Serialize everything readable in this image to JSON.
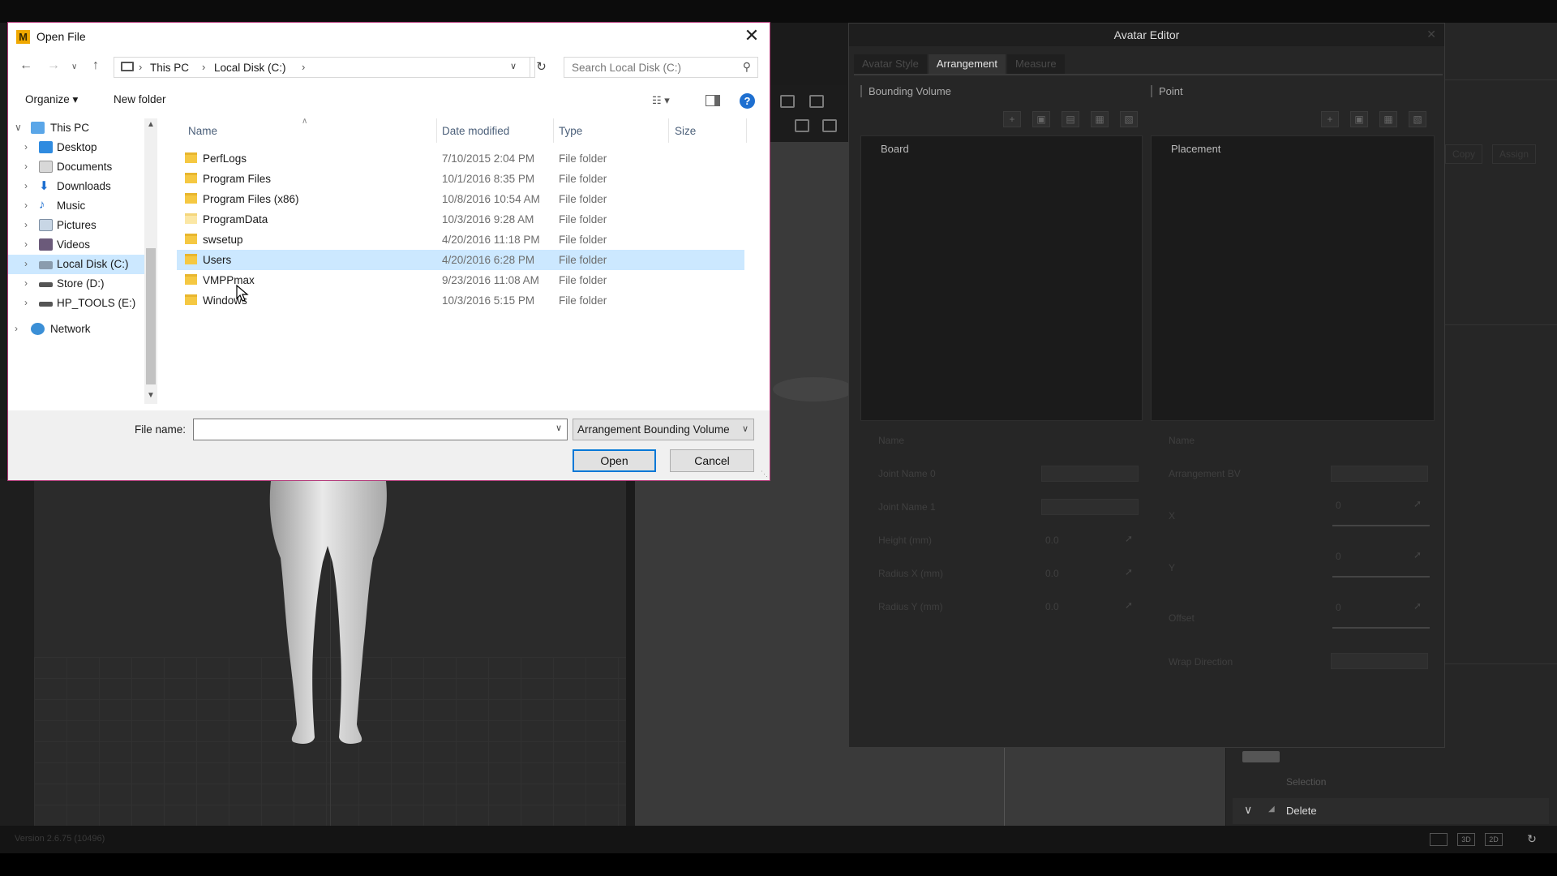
{
  "dialog": {
    "title": "Open File",
    "app_icon_letter": "M",
    "breadcrumbs": [
      "This PC",
      "Local Disk (C:)"
    ],
    "search_placeholder": "Search Local Disk (C:)",
    "organize_label": "Organize ▾",
    "new_folder_label": "New folder",
    "help_label": "?",
    "tree": [
      {
        "label": "This PC",
        "icon": "pc-icon",
        "level": 0,
        "expanded": true
      },
      {
        "label": "Desktop",
        "icon": "desktop-icon",
        "level": 1
      },
      {
        "label": "Documents",
        "icon": "documents-icon",
        "level": 1
      },
      {
        "label": "Downloads",
        "icon": "downloads-icon",
        "level": 1
      },
      {
        "label": "Music",
        "icon": "music-icon",
        "level": 1
      },
      {
        "label": "Pictures",
        "icon": "pictures-icon",
        "level": 1
      },
      {
        "label": "Videos",
        "icon": "videos-icon",
        "level": 1
      },
      {
        "label": "Local Disk (C:)",
        "icon": "drive-icon",
        "level": 1,
        "selected": true
      },
      {
        "label": "Store (D:)",
        "icon": "drive-icon",
        "level": 1
      },
      {
        "label": "HP_TOOLS (E:)",
        "icon": "drive-icon",
        "level": 1
      },
      {
        "label": "Network",
        "icon": "network-icon",
        "level": 0
      }
    ],
    "columns": [
      "Name",
      "Date modified",
      "Type",
      "Size"
    ],
    "files": [
      {
        "name": "PerfLogs",
        "date": "7/10/2015 2:04 PM",
        "type": "File folder"
      },
      {
        "name": "Program Files",
        "date": "10/1/2016 8:35 PM",
        "type": "File folder"
      },
      {
        "name": "Program Files (x86)",
        "date": "10/8/2016 10:54 AM",
        "type": "File folder"
      },
      {
        "name": "ProgramData",
        "date": "10/3/2016 9:28 AM",
        "type": "File folder",
        "hidden": true
      },
      {
        "name": "swsetup",
        "date": "4/20/2016 11:18 PM",
        "type": "File folder"
      },
      {
        "name": "Users",
        "date": "4/20/2016 6:28 PM",
        "type": "File folder",
        "selected": true
      },
      {
        "name": "VMPPmax",
        "date": "9/23/2016 11:08 AM",
        "type": "File folder"
      },
      {
        "name": "Windows",
        "date": "10/3/2016 5:15 PM",
        "type": "File folder"
      }
    ],
    "file_name_label": "File name:",
    "file_name_value": "",
    "filter_value": "Arrangement Bounding Volume",
    "open_label": "Open",
    "cancel_label": "Cancel"
  },
  "avatar_editor": {
    "title": "Avatar Editor",
    "tabs": [
      "Avatar Style",
      "Arrangement",
      "Measure"
    ],
    "active_tab": "Arrangement",
    "left_section": "Bounding Volume",
    "right_section": "Point",
    "left_list_header": "Board",
    "right_list_header": "Placement",
    "left_props": [
      "Name",
      "Joint Name 0",
      "Joint Name 1",
      "Height (mm)",
      "Radius X (mm)",
      "Radius Y (mm)"
    ],
    "left_values": [
      "0.0",
      "0.0",
      "0.0"
    ],
    "right_props": [
      "Name",
      "Arrangement BV",
      "X",
      "Y",
      "Offset",
      "Wrap Direction"
    ],
    "right_values": [
      "0",
      "0",
      "0"
    ]
  },
  "background": {
    "delete_label": "Delete",
    "selection_label": "Selection",
    "status_text": "Version 2.6.75   (10496)",
    "copy_label": "Copy",
    "assign_label": "Assign",
    "view_buttons": [
      "3D",
      "2D"
    ]
  }
}
